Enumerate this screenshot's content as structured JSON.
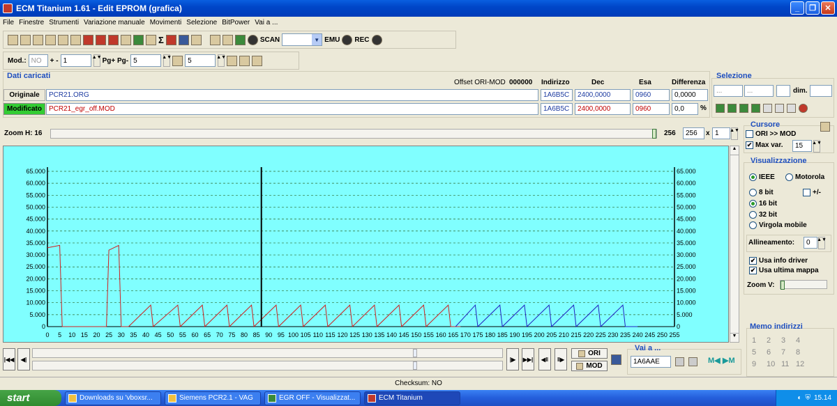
{
  "window": {
    "title": "ECM Titanium 1.61 - Edit EPROM (grafica)"
  },
  "menu": [
    "File",
    "Finestre",
    "Strumenti",
    "Variazione manuale",
    "Movimenti",
    "Selezione",
    "BitPower",
    "Vai a ..."
  ],
  "toolbar1": {
    "scan_label": "SCAN",
    "emu_label": "EMU",
    "rec_label": "REC"
  },
  "toolbar2": {
    "mod_label": "Mod.:",
    "mod_value": "NO",
    "plusminus_label": "+ -",
    "plusminus_value": "1",
    "pg_label": "Pg+ Pg-",
    "pg_value": "5",
    "p_value": "5"
  },
  "dati": {
    "header": "Dati caricati",
    "offset_label": "Offset ORI-MOD",
    "offset_value": "000000",
    "cols": {
      "indirizzo": "Indirizzo",
      "dec": "Dec",
      "esa": "Esa",
      "diff": "Differenza"
    },
    "originale": {
      "label": "Originale",
      "file": "PCR21.ORG",
      "addr": "1A6B5C",
      "dec": "2400,0000",
      "esa": "0960",
      "diff": "0,0000"
    },
    "modificato": {
      "label": "Modificato",
      "file": "PCR21_egr_off.MOD",
      "addr": "1A6B5C",
      "dec": "2400,0000",
      "esa": "0960",
      "diff": "0,0",
      "pct": "%"
    }
  },
  "selezione": {
    "header": "Selezione",
    "f1": "...",
    "f2": "...",
    "dim_label": "dim."
  },
  "zoom": {
    "label": "Zoom H: 16",
    "value_text": "256",
    "input": "256",
    "x": "x",
    "mult": "1"
  },
  "cursore": {
    "header": "Cursore",
    "ori_mod": "ORI >> MOD",
    "max_var_label": "Max var.",
    "max_var_value": "15"
  },
  "visualizzazione": {
    "header": "Visualizzazione",
    "ieee": "IEEE",
    "motorola": "Motorola",
    "b8": "8 bit",
    "pm": "+/-",
    "b16": "16 bit",
    "b32": "32 bit",
    "virgola": "Virgola mobile",
    "allineamento_label": "Allineamento:",
    "allineamento_value": "0",
    "usa_info": "Usa info driver",
    "usa_ultima": "Usa ultima mappa",
    "zoom_v": "Zoom V:"
  },
  "memo": {
    "header": "Memo indirizzi",
    "nums": [
      "1",
      "2",
      "3",
      "4",
      "5",
      "6",
      "7",
      "8",
      "9",
      "10",
      "11",
      "12"
    ]
  },
  "vai": {
    "header": "Vai a ...",
    "value": "1A6AAE",
    "ori": "ORI",
    "mod": "MOD"
  },
  "status": {
    "checksum": "Checksum: NO"
  },
  "taskbar": {
    "start": "start",
    "tasks": [
      "Downloads su 'vboxsr...",
      "Siemens PCR2.1 - VAG",
      "EGR OFF - Visualizzat...",
      "ECM Titanium"
    ],
    "clock": "15.14"
  },
  "colors": {
    "orig": "#d02020",
    "mod": "#2020c0",
    "chart_bg": "#80ffff",
    "modificato_bg": "#33cc33"
  },
  "chart_data": {
    "type": "line",
    "ylim": [
      0,
      65000
    ],
    "xlim": [
      0,
      255
    ],
    "y_ticks": [
      "0",
      "5.000",
      "10.000",
      "15.000",
      "20.000",
      "25.000",
      "30.000",
      "35.000",
      "40.000",
      "45.000",
      "50.000",
      "55.000",
      "60.000",
      "65.000"
    ],
    "x_ticks": [
      "0",
      "5",
      "10",
      "15",
      "20",
      "25",
      "30",
      "35",
      "40",
      "45",
      "50",
      "55",
      "60",
      "65",
      "70",
      "75",
      "80",
      "85",
      "90",
      "95",
      "100",
      "105",
      "110",
      "115",
      "120",
      "125",
      "130",
      "135",
      "140",
      "145",
      "150",
      "155",
      "160",
      "165",
      "170",
      "175",
      "180",
      "185",
      "190",
      "195",
      "200",
      "205",
      "210",
      "215",
      "220",
      "225",
      "230",
      "235",
      "240",
      "245",
      "250",
      "255"
    ],
    "cursor_x": 87,
    "series": [
      {
        "color": "#d02020",
        "points": [
          [
            0,
            33000
          ],
          [
            5,
            34000
          ],
          [
            6,
            0
          ],
          [
            24,
            0
          ],
          [
            25,
            32000
          ],
          [
            29,
            34000
          ],
          [
            30,
            0
          ],
          [
            33,
            0
          ],
          [
            42,
            9000
          ],
          [
            43,
            0
          ],
          [
            53,
            9000
          ],
          [
            54,
            0
          ],
          [
            63,
            9000
          ],
          [
            64,
            0
          ],
          [
            73,
            9000
          ],
          [
            74,
            0
          ],
          [
            83,
            9000
          ],
          [
            84,
            0
          ],
          [
            93,
            9000
          ],
          [
            94,
            0
          ],
          [
            103,
            9000
          ],
          [
            104,
            0
          ],
          [
            113,
            9000
          ],
          [
            114,
            0
          ],
          [
            123,
            9000
          ],
          [
            124,
            0
          ],
          [
            133,
            9000
          ],
          [
            134,
            0
          ],
          [
            143,
            9000
          ],
          [
            144,
            0
          ],
          [
            153,
            9000
          ],
          [
            154,
            0
          ],
          [
            163,
            9000
          ],
          [
            164,
            0
          ],
          [
            168,
            0
          ]
        ]
      },
      {
        "color": "#2020c0",
        "points": [
          [
            166,
            0
          ],
          [
            174,
            9000
          ],
          [
            175,
            0
          ],
          [
            184,
            9000
          ],
          [
            185,
            0
          ],
          [
            194,
            9000
          ],
          [
            195,
            0
          ],
          [
            204,
            9000
          ],
          [
            205,
            0
          ],
          [
            214,
            9000
          ],
          [
            215,
            0
          ],
          [
            224,
            9000
          ],
          [
            225,
            0
          ],
          [
            234,
            9000
          ],
          [
            235,
            0
          ],
          [
            240,
            0
          ]
        ]
      }
    ]
  }
}
